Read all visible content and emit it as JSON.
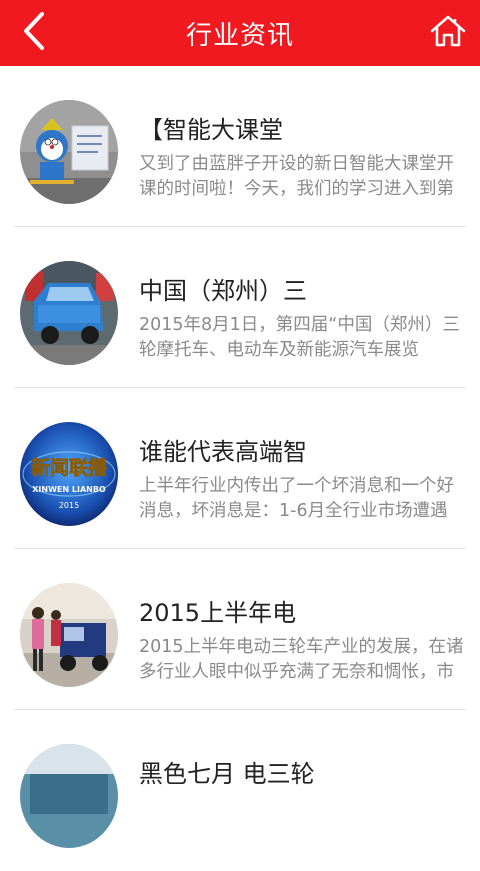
{
  "header": {
    "title": "行业资讯",
    "back_icon": "chevron-left-icon",
    "home_icon": "home-icon",
    "background_color": "#f0191f"
  },
  "articles": [
    {
      "title": "【智能大课堂",
      "summary": "又到了由蓝胖子开设的新日智能大课堂开课的时间啦！今天，我们的学习进入到第"
    },
    {
      "title": "中国（郑州）三",
      "summary": "2015年8月1日，第四届“中国（郑州）三轮摩托车、电动车及新能源汽车展览"
    },
    {
      "title": "谁能代表高端智",
      "summary": "上半年行业内传出了一个坏消息和一个好消息，坏消息是：1-6月全行业市场遭遇",
      "thumb_text": {
        "main": "新闻联播",
        "sub": "XINWEN LIANBO",
        "year": "2015"
      }
    },
    {
      "title": "2015上半年电",
      "summary": "2015上半年电动三轮车产业的发展，在诸多行业人眼中似乎充满了无奈和惆怅，市"
    },
    {
      "title": "黑色七月 电三轮",
      "summary": ""
    }
  ]
}
